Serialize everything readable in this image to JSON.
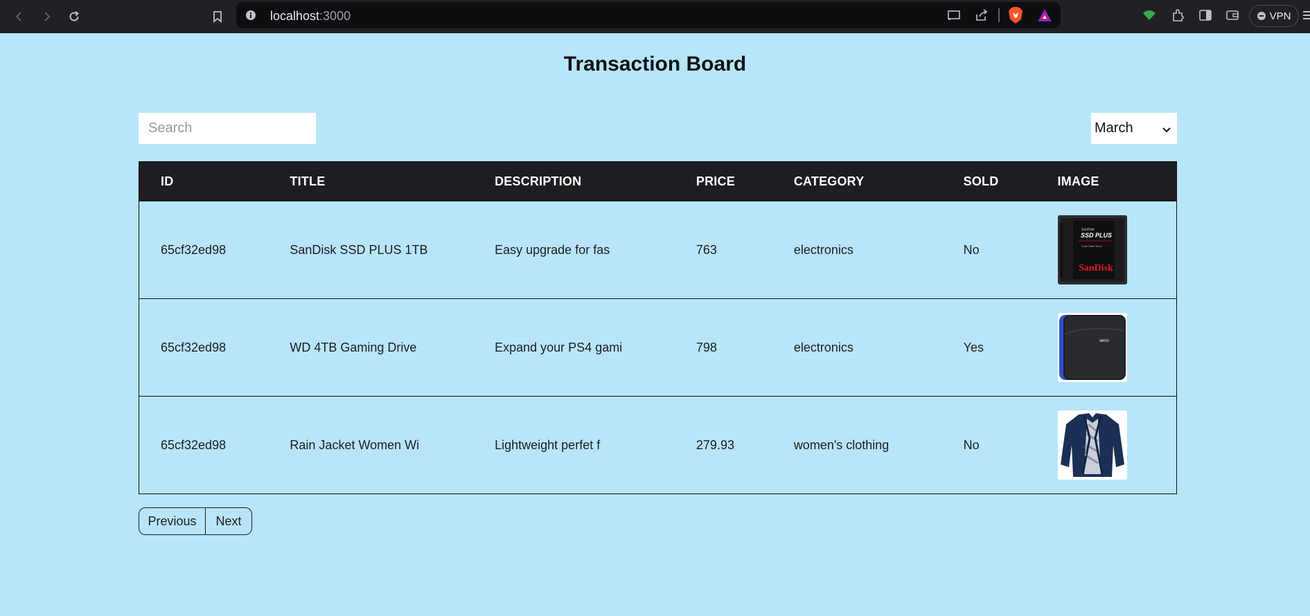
{
  "browser": {
    "url_host": "localhost",
    "url_port": ":3000",
    "vpn_label": "VPN",
    "icons": [
      "back-icon",
      "forward-icon",
      "reload-icon",
      "bookmark-icon",
      "site-info-icon",
      "cast-icon",
      "share-icon",
      "brave-shield-icon",
      "rewards-icon",
      "wallet-network-icon",
      "extensions-icon",
      "sidebar-icon",
      "wallet-icon",
      "menu-icon"
    ]
  },
  "page": {
    "title": "Transaction Board",
    "search_placeholder": "Search",
    "month_selected": "March"
  },
  "table": {
    "headers": [
      "ID",
      "TITLE",
      "DESCRIPTION",
      "PRICE",
      "CATEGORY",
      "SOLD",
      "IMAGE"
    ],
    "rows": [
      {
        "id": "65cf32ed98",
        "title": "SanDisk SSD PLUS 1TB",
        "description": "Easy upgrade for fas",
        "price": "763",
        "category": "electronics",
        "sold": "No",
        "image": "ssd-image",
        "image_text": {
          "line1": "SanDisk",
          "line2": "SSD PLUS",
          "line3": "Solid State Drive",
          "brand": "SanDisk"
        }
      },
      {
        "id": "65cf32ed98",
        "title": "WD 4TB Gaming Drive",
        "description": "Expand your PS4 gami",
        "price": "798",
        "category": "electronics",
        "sold": "Yes",
        "image": "hard-drive-image",
        "image_text": {
          "brand": "WD"
        }
      },
      {
        "id": "65cf32ed98",
        "title": "Rain Jacket Women Wi",
        "description": "Lightweight perfet f",
        "price": "279.93",
        "category": "women's clothing",
        "sold": "No",
        "image": "jacket-image"
      }
    ]
  },
  "pagination": {
    "previous_label": "Previous",
    "next_label": "Next"
  },
  "colors": {
    "page_bg": "#b8e5f9",
    "header_bg": "#1d1d22",
    "chrome_bg": "#202124"
  }
}
